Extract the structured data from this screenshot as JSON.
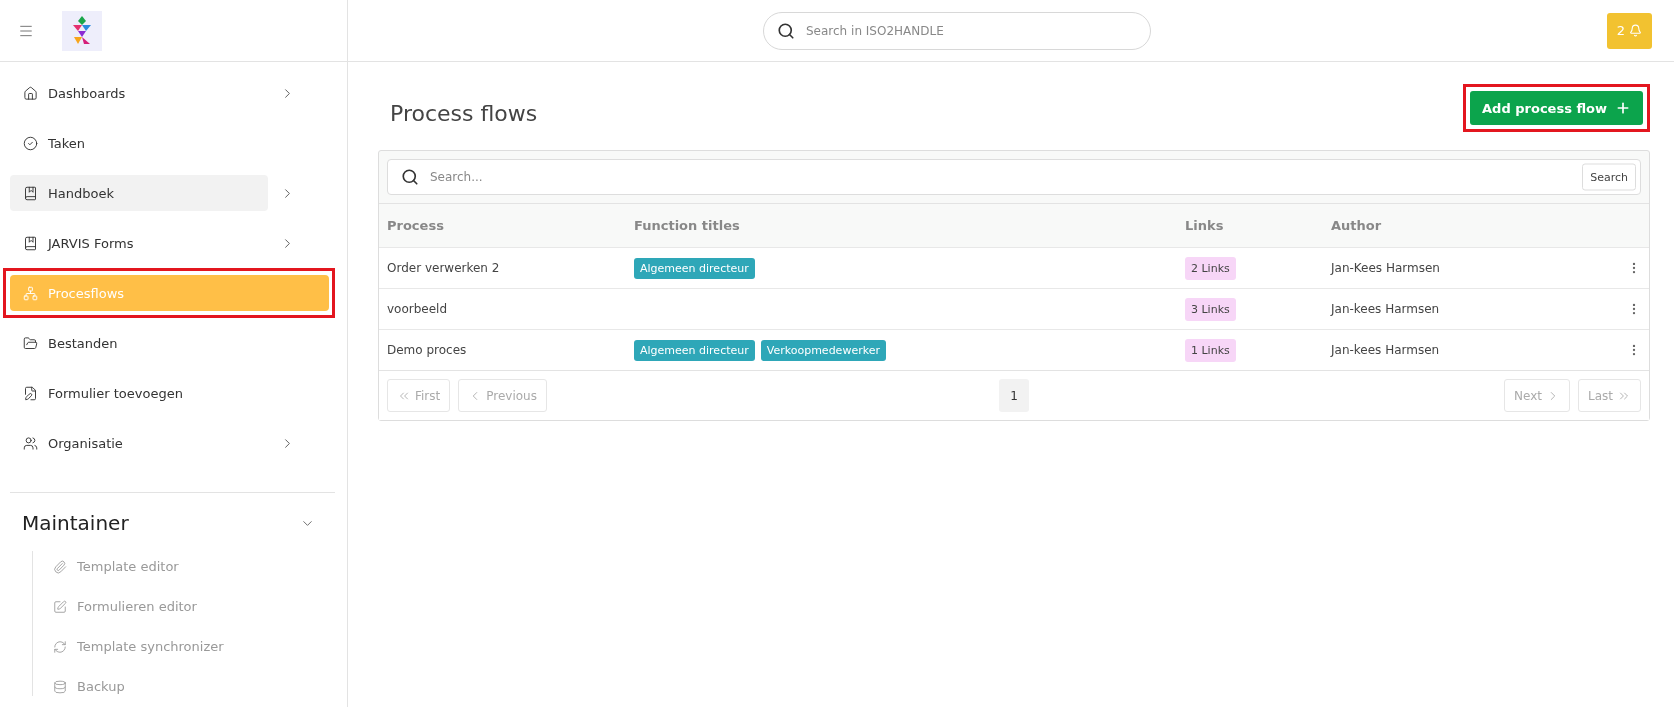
{
  "header": {
    "search": {
      "placeholder": "Search in ISO2HANDLE"
    },
    "notifications": {
      "count": "2"
    }
  },
  "sidebar": {
    "items": [
      {
        "label": "Dashboards",
        "expandable": true,
        "selected": false,
        "hovered": false,
        "annotated": false
      },
      {
        "label": "Taken",
        "expandable": false,
        "selected": false,
        "hovered": false,
        "annotated": false
      },
      {
        "label": "Handboek",
        "expandable": true,
        "selected": false,
        "hovered": true,
        "annotated": false
      },
      {
        "label": "JARVIS Forms",
        "expandable": true,
        "selected": false,
        "hovered": false,
        "annotated": false
      },
      {
        "label": "Procesflows",
        "expandable": false,
        "selected": true,
        "hovered": false,
        "annotated": true
      },
      {
        "label": "Bestanden",
        "expandable": false,
        "selected": false,
        "hovered": false,
        "annotated": false
      },
      {
        "label": "Formulier toevoegen",
        "expandable": false,
        "selected": false,
        "hovered": false,
        "annotated": false
      },
      {
        "label": "Organisatie",
        "expandable": true,
        "selected": false,
        "hovered": false,
        "annotated": false
      }
    ],
    "section": {
      "title": "Maintainer",
      "expanded": true,
      "items": [
        "Template editor",
        "Formulieren editor",
        "Template synchronizer",
        "Backup"
      ]
    }
  },
  "page": {
    "title": "Process flows",
    "add_button": {
      "label": "Add process flow",
      "annotated": true
    }
  },
  "table": {
    "search": {
      "placeholder": "Search...",
      "button": "Search"
    },
    "columns": [
      "Process",
      "Function titles",
      "Links",
      "Author"
    ],
    "rows": [
      {
        "process": "Order verwerken 2",
        "function_titles": [
          "Algemeen directeur"
        ],
        "links": "2 Links",
        "author": "Jan-Kees Harmsen"
      },
      {
        "process": "voorbeeld",
        "function_titles": [],
        "links": "3 Links",
        "author": "Jan-kees Harmsen"
      },
      {
        "process": "Demo proces",
        "function_titles": [
          "Algemeen directeur",
          "Verkoopmedewerker"
        ],
        "links": "1 Links",
        "author": "Jan-kees Harmsen"
      }
    ],
    "pagination": {
      "first": {
        "label": "First",
        "disabled": true
      },
      "previous": {
        "label": "Previous",
        "disabled": true
      },
      "pages": [
        {
          "label": "1",
          "selected": true
        }
      ],
      "next": {
        "label": "Next",
        "disabled": true
      },
      "last": {
        "label": "Last",
        "disabled": true
      }
    }
  }
}
